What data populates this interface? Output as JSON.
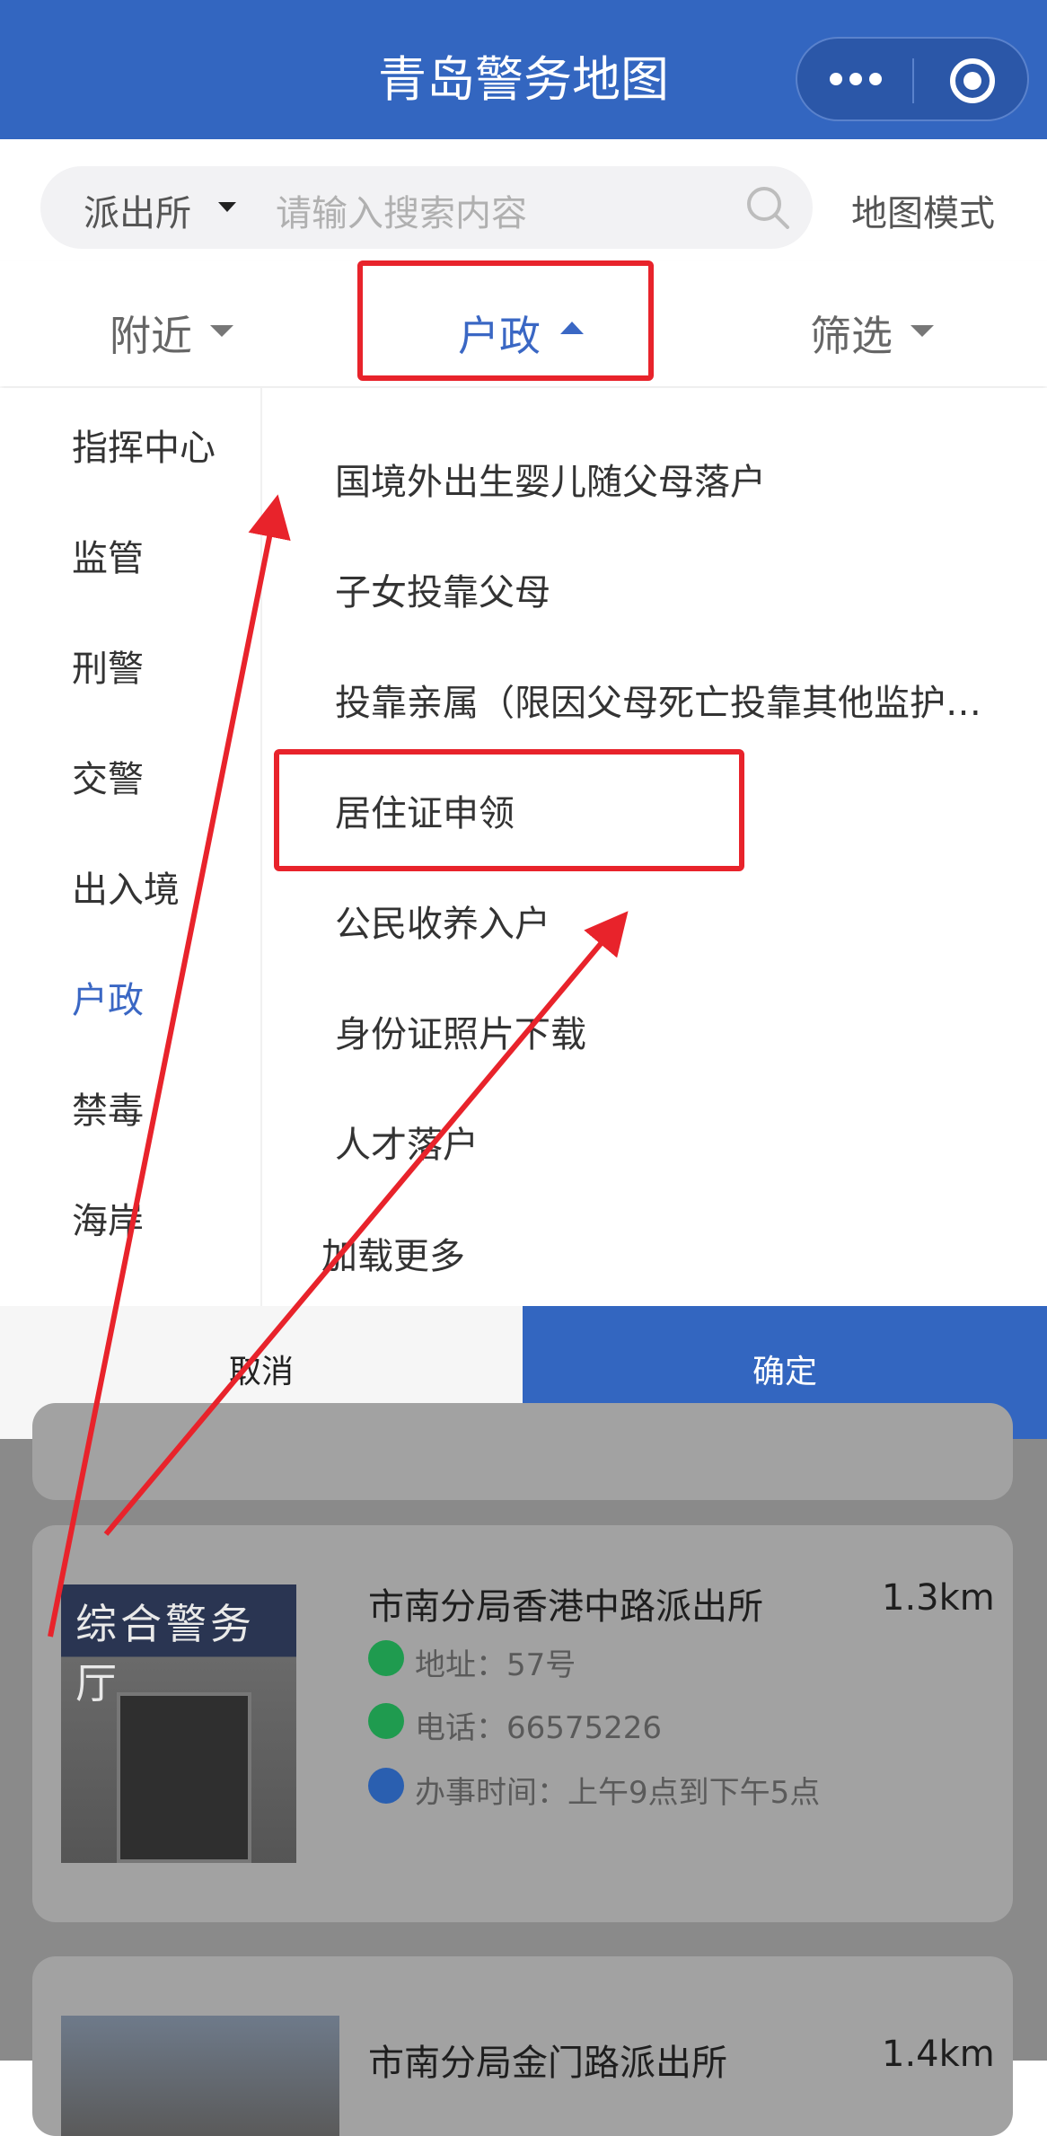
{
  "header": {
    "title": "青岛警务地图",
    "more_icon": "more-dots-icon",
    "target_icon": "target-icon",
    "color": "#3366c0"
  },
  "search": {
    "category": "派出所",
    "placeholder": "请输入搜索内容",
    "map_mode": "地图模式"
  },
  "tabs": {
    "nearby": "附近",
    "huzheng": "户政",
    "filter": "筛选"
  },
  "left_categories": [
    "指挥中心",
    "监管",
    "刑警",
    "交警",
    "出入境",
    "户政",
    "禁毒",
    "海岸"
  ],
  "left_selected": "户政",
  "right_items": [
    "国境外出生婴儿随父母落户",
    "子女投靠父母",
    "投靠亲属（限因父母死亡投靠其他监护…",
    "居住证申领",
    "公民收养入户",
    "身份证照片下载",
    "人才落户"
  ],
  "load_more": "加载更多",
  "buttons": {
    "cancel": "取消",
    "confirm": "确定"
  },
  "cards": [
    {
      "title": "市南分局香港中路派出所",
      "distance": "1.3km",
      "photo_sign": "综合警务厅",
      "address": "地址：57号",
      "phone": "电话：66575226",
      "hours": "办事时间：上午9点到下午5点"
    },
    {
      "title": "市南分局金门路派出所",
      "distance": "1.4km"
    }
  ],
  "annotation_color": "#e8232b"
}
